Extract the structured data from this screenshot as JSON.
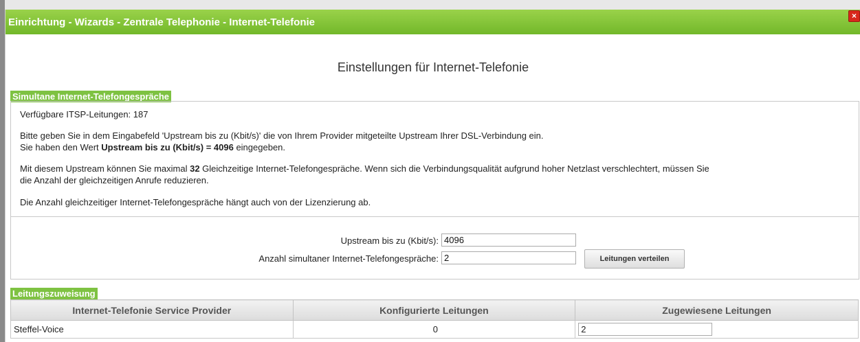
{
  "window": {
    "title": "Einrichtung - Wizards - Zentrale Telephonie - Internet-Telefonie",
    "close_symbol": "×"
  },
  "page": {
    "heading": "Einstellungen für Internet-Telefonie"
  },
  "simultaneous": {
    "legend": "Simultane Internet-Telefongespräche",
    "available_lines": "Verfügbare ITSP-Leitungen: 187",
    "info_line1": "Bitte geben Sie in dem Eingabefeld 'Upstream bis zu (Kbit/s)' die von Ihrem Provider mitgeteilte Upstream Ihrer DSL-Verbindung ein.",
    "info_line2_prefix": "Sie haben den Wert ",
    "info_line2_bold": "Upstream bis zu (Kbit/s) = 4096",
    "info_line2_suffix": " eingegeben.",
    "capacity_prefix": "Mit diesem Upstream können Sie maximal ",
    "capacity_bold": "32",
    "capacity_suffix": " Gleichzeitige Internet-Telefongespräche. Wenn sich die Verbindungsqualität aufgrund hoher Netzlast verschlechtert, müssen Sie",
    "capacity_line2": "die Anzahl der gleichzeitigen Anrufe reduzieren.",
    "license_note": "Die Anzahl gleichzeitiger Internet-Telefongespräche hängt auch von der Lizenzierung ab."
  },
  "form": {
    "upstream_label": "Upstream bis zu (Kbit/s):",
    "upstream_value": "4096",
    "simultaneous_label": "Anzahl simultaner Internet-Telefongespräche:",
    "simultaneous_value": "2",
    "distribute_button": "Leitungen verteilen"
  },
  "assignment": {
    "legend": "Leitungszuweisung",
    "columns": [
      "Internet-Telefonie Service Provider",
      "Konfigurierte Leitungen",
      "Zugewiesene Leitungen"
    ],
    "rows": [
      {
        "provider": "Steffel-Voice",
        "configured": "0",
        "assigned": "2"
      }
    ]
  },
  "colors": {
    "accent": "#7ec242",
    "close": "#d8281c"
  }
}
